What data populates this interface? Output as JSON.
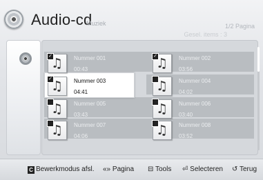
{
  "header": {
    "title": "Audio-cd",
    "subtitle": "Muziek",
    "page_indicator": "1/2 Pagina",
    "selected_items": "Gesel. items : 3"
  },
  "tracks": [
    {
      "name": "Nummer 001",
      "time": "00:43",
      "checked": true,
      "focused": false
    },
    {
      "name": "Nummer 002",
      "time": "03:56",
      "checked": true,
      "focused": false
    },
    {
      "name": "Nummer 003",
      "time": "04:41",
      "checked": true,
      "focused": true
    },
    {
      "name": "Nummer 004",
      "time": "04:02",
      "checked": false,
      "focused": false
    },
    {
      "name": "Nummer 005",
      "time": "03:43",
      "checked": false,
      "focused": false
    },
    {
      "name": "Nummer 006",
      "time": "03:40",
      "checked": false,
      "focused": false
    },
    {
      "name": "Nummer 007",
      "time": "04:06",
      "checked": false,
      "focused": false
    },
    {
      "name": "Nummer 008",
      "time": "03:52",
      "checked": false,
      "focused": false
    }
  ],
  "footer": {
    "edit_key": "C",
    "edit_label": "Bewerkmodus afsl.",
    "page_icon": "«»",
    "page_label": "Pagina",
    "tools_icon": "⊟",
    "tools_label": "Tools",
    "select_icon": "⏎",
    "select_label": "Selecteren",
    "back_icon": "↺",
    "back_label": "Terug"
  },
  "icons": {
    "music_note": "♫",
    "check": "✓"
  },
  "colors": {
    "focus": "#ffffff",
    "row_dim": "#a3a7ac"
  }
}
